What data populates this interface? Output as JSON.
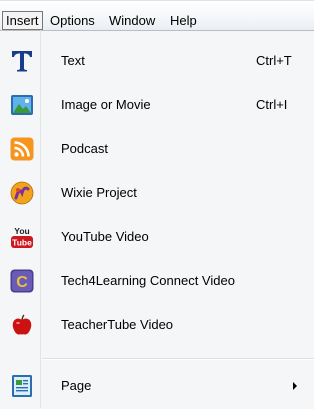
{
  "menubar": {
    "items": [
      {
        "label": "Insert"
      },
      {
        "label": "Options"
      },
      {
        "label": "Window"
      },
      {
        "label": "Help"
      }
    ]
  },
  "menu": {
    "items": [
      {
        "label": "Text",
        "shortcut": "Ctrl+T",
        "icon": "text-t-icon"
      },
      {
        "label": "Image or Movie",
        "shortcut": "Ctrl+I",
        "icon": "image-icon"
      },
      {
        "label": "Podcast",
        "shortcut": "",
        "icon": "podcast-rss-icon"
      },
      {
        "label": "Wixie Project",
        "shortcut": "",
        "icon": "wixie-icon"
      },
      {
        "label": "YouTube Video",
        "shortcut": "",
        "icon": "youtube-icon"
      },
      {
        "label": "Tech4Learning Connect Video",
        "shortcut": "",
        "icon": "tech4learning-icon"
      },
      {
        "label": "TeacherTube Video",
        "shortcut": "",
        "icon": "teachertube-apple-icon"
      },
      {
        "label": "Page",
        "shortcut": "",
        "icon": "page-icon",
        "submenu": true
      }
    ]
  },
  "colors": {
    "text_icon": "#1a3c8c",
    "podcast": "#f7941d",
    "youtube": "#cc181e",
    "apple": "#cc1111"
  }
}
